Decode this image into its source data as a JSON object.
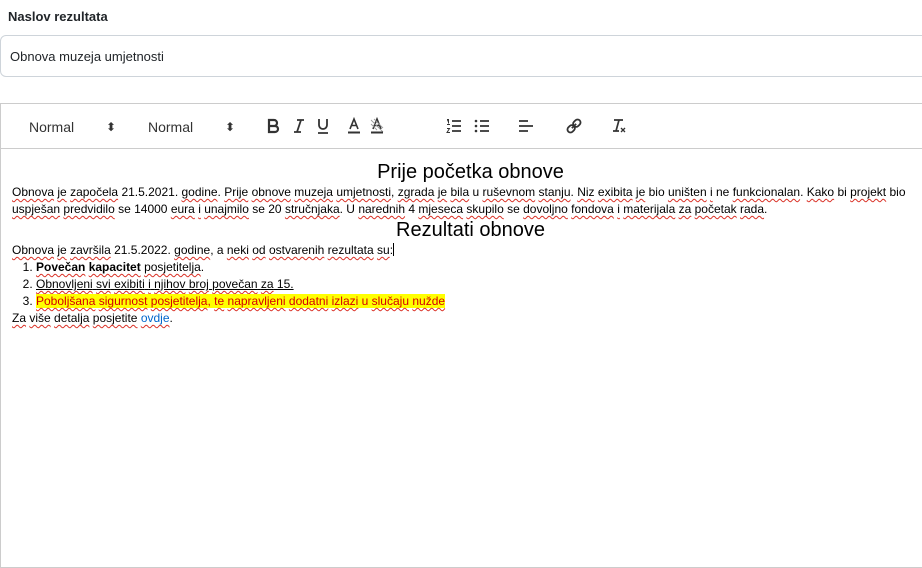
{
  "title_field": {
    "label": "Naslov rezultata",
    "value": "Obnova muzeja umjetnosti"
  },
  "toolbar": {
    "header_picker": "Normal",
    "size_picker": "Normal",
    "picker_arrow": "⬍",
    "buttons": [
      "bold",
      "italic",
      "underline",
      "text-color",
      "background-color",
      "ordered-list",
      "bullet-list",
      "align",
      "link",
      "clean"
    ]
  },
  "content": {
    "heading1": "Prije početka obnove",
    "para1": {
      "w1": "Obnova",
      "t1": " ",
      "w2": "je",
      "t2": " ",
      "w3": "započela",
      "t3": " 21.5.2021. ",
      "w4": "godine",
      "t4": ". ",
      "w5": "Prije",
      "t5": " ",
      "w6": "obnove",
      "t6": " ",
      "w7": "muzeja",
      "t7": " ",
      "w8": "umjetnosti",
      "t8": ", ",
      "w9": "zgrada",
      "t9": " ",
      "w10": "je",
      "t10": " ",
      "w11": "bila",
      "t11": " u ",
      "w12": "ruševnom",
      "t12": " ",
      "w13": "stanju",
      "t13": ". ",
      "w14": "Niz",
      "t14": " ",
      "w15": "exibita",
      "t15": " ",
      "w16": "je",
      "t16": " bio ",
      "w17": "uništen",
      "t17": " ",
      "w18": "i",
      "t18": " ne ",
      "w19": "funkcionalan",
      "t19": ". ",
      "w20": "Kako",
      "t20": " bi ",
      "w21": "projekt",
      "t21": " bio ",
      "w22": "uspješan",
      "t22": " ",
      "w23": "predvidilo",
      "t23": " se 14000 ",
      "w24": "eura",
      "t24": " ",
      "w25": "i",
      "t25": " ",
      "w26": "unajmilo",
      "t26": " se 20 ",
      "w27": "stručnjaka",
      "t27": ". U ",
      "w28": "narednih",
      "t28": " 4 ",
      "w29": "mjeseca",
      "t29": " ",
      "w30": "skupilo",
      "t30": " se ",
      "w31": "dovoljno",
      "t31": " ",
      "w32": "fondova",
      "t32": " ",
      "w33": "i",
      "t33": " ",
      "w34": "materijala",
      "t34": " ",
      "w35": "za",
      "t35": " ",
      "w36": "početak",
      "t36": " ",
      "w37": "rada",
      "t37": "."
    },
    "heading2": "Rezultati obnove",
    "para2": {
      "w1": "Obnova",
      "t1": " ",
      "w2": "je",
      "t2": " ",
      "w3": "završila",
      "t3": " 21.5.2022. ",
      "w4": "godine",
      "t4": ", a ",
      "w5": "neki",
      "t5": " ",
      "w6": "od",
      "t6": " ",
      "w7": "ostvarenih",
      "t7": " ",
      "w8": "rezultata",
      "t8": " ",
      "w9": "su",
      "t9": ":"
    },
    "list": {
      "item1": {
        "b1": "Povečan",
        "t1": " ",
        "b2": "kapacitet",
        "t2": " ",
        "w3": "posjetitelja",
        "t3": "."
      },
      "item2": {
        "w1": "Obnovljeni",
        "t1": " ",
        "w2": "svi",
        "t2": " ",
        "w3": "exibiti",
        "t3": " ",
        "w4": "i",
        "t4": " ",
        "w5": "njihov",
        "t5": " ",
        "w6": "broj",
        "t6": " ",
        "w7": "povečan",
        "t7": " ",
        "w8": "za",
        "t8": " 15."
      },
      "item3": {
        "w1": "Poboljšana",
        "t1": " ",
        "w2": "sigurnost",
        "t2": " ",
        "w3": "posjetitelja",
        "t3": ", ",
        "w4": "te",
        "t4": " ",
        "w5": "napravljeni",
        "t5": " ",
        "w6": "dodatni",
        "t6": " ",
        "w7": "izlazi",
        "t7": " u ",
        "w8": "slučaju",
        "t8": " ",
        "w9": "nužde"
      }
    },
    "para3": {
      "w1": "Za",
      "t1": " ",
      "w2": "više",
      "t2": " ",
      "w3": "detalja",
      "t3": " ",
      "w4": "posjetite",
      "t4": " ",
      "link": "ovdje",
      "t5": "."
    }
  },
  "colors": {
    "highlight_bg": "#ffff00",
    "highlight_text": "#d40000",
    "link": "#0066cc",
    "spellcheck": "#d93025"
  }
}
